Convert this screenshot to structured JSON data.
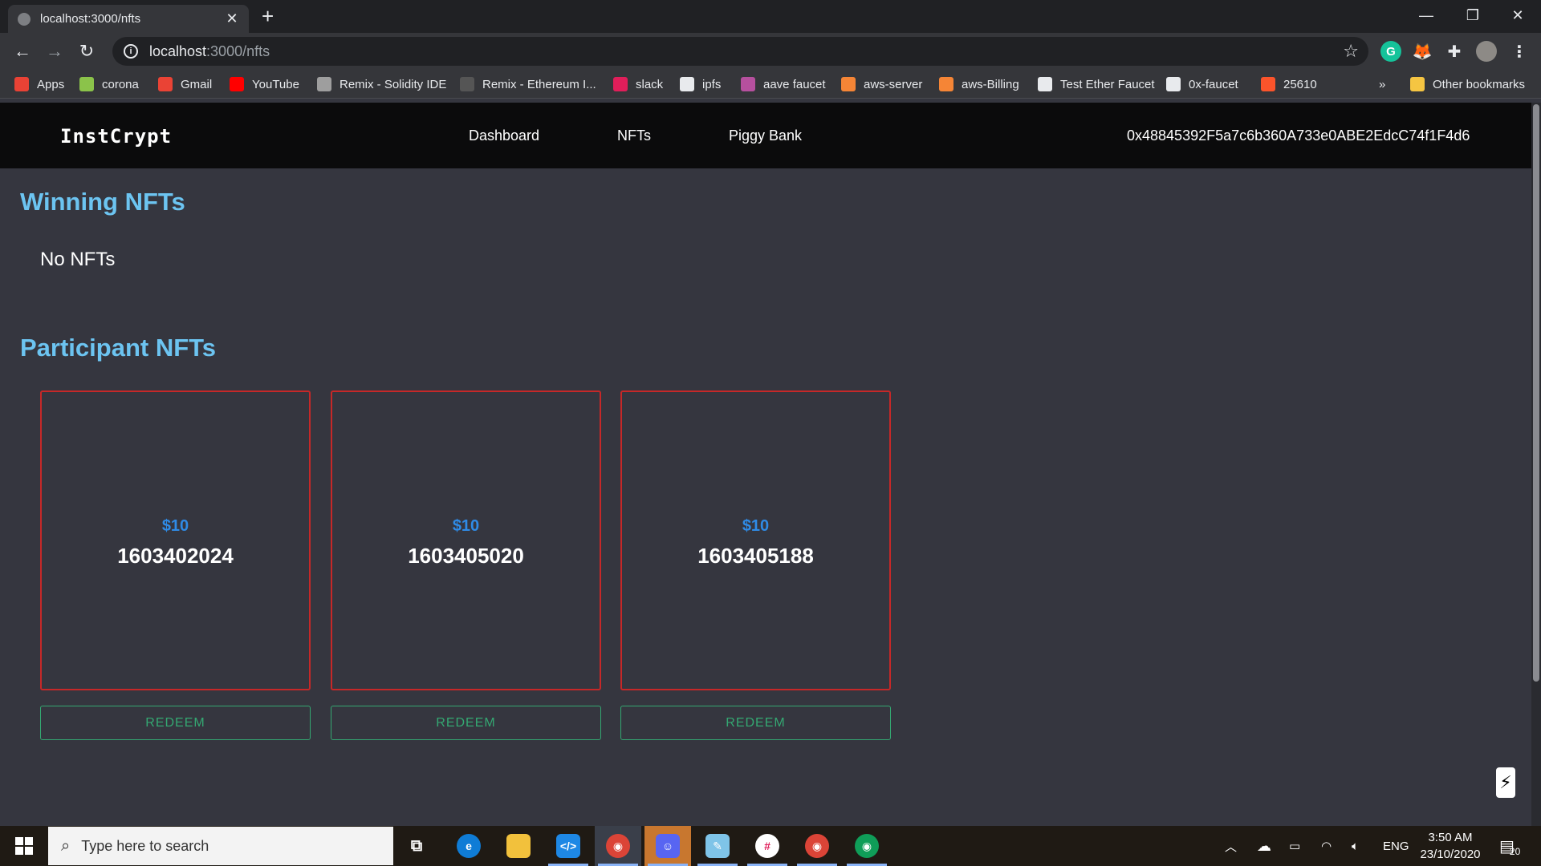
{
  "browser": {
    "tab_title": "localhost:3000/nfts",
    "tab_close": "✕",
    "new_tab": "+",
    "url_host": "localhost",
    "url_path": ":3000/nfts",
    "bookmarks": [
      {
        "label": "Apps",
        "icon": "apps-grid-icon",
        "color": "#e94235"
      },
      {
        "label": "corona",
        "icon": "corona-favicon-icon",
        "color": "#8bc34a"
      },
      {
        "label": "Gmail",
        "icon": "gmail-icon",
        "color": "#ea4335"
      },
      {
        "label": "YouTube",
        "icon": "youtube-icon",
        "color": "#ff0000"
      },
      {
        "label": "Remix - Solidity IDE",
        "icon": "ethereum-icon",
        "color": "#9e9e9e"
      },
      {
        "label": "Remix - Ethereum I...",
        "icon": "remix-icon",
        "color": "#555555"
      },
      {
        "label": "slack",
        "icon": "slack-icon",
        "color": "#e01e5a"
      },
      {
        "label": "ipfs",
        "icon": "globe-icon",
        "color": "#e8eaed"
      },
      {
        "label": "aave faucet",
        "icon": "aave-icon",
        "color": "#b6509e"
      },
      {
        "label": "aws-server",
        "icon": "aws-icon",
        "color": "#f58536"
      },
      {
        "label": "aws-Billing",
        "icon": "aws-icon",
        "color": "#f58536"
      },
      {
        "label": "Test Ether Faucet",
        "icon": "globe-icon",
        "color": "#e8eaed"
      },
      {
        "label": "0x-faucet",
        "icon": "github-icon",
        "color": "#e8eaed"
      },
      {
        "label": "25610",
        "icon": "brave-icon",
        "color": "#fb542b"
      }
    ],
    "more_bookmarks": "»",
    "other_bookmarks": "Other bookmarks"
  },
  "app": {
    "brand": "InstCrypt",
    "nav": [
      "Dashboard",
      "NFTs",
      "Piggy Bank"
    ],
    "wallet_address": "0x48845392F5a7c6b360A733e0ABE2EdcC74f1F4d6",
    "winning_title": "Winning NFTs",
    "winning_empty": "No NFTs",
    "participant_title": "Participant NFTs",
    "cards": [
      {
        "price": "$10",
        "token_id": "1603402024",
        "button": "REDEEM"
      },
      {
        "price": "$10",
        "token_id": "1603405020",
        "button": "REDEEM"
      },
      {
        "price": "$10",
        "token_id": "1603405188",
        "button": "REDEEM"
      }
    ],
    "fab_icon": "⚡"
  },
  "taskbar": {
    "search_placeholder": "Type here to search",
    "language": "ENG",
    "time": "3:50 AM",
    "date": "23/10/2020",
    "notifications": "20"
  },
  "colors": {
    "page_bg": "#35363f",
    "heading": "#6cc4f1",
    "card_border": "#c62828",
    "price": "#2f8be6",
    "redeem": "#34a872"
  }
}
